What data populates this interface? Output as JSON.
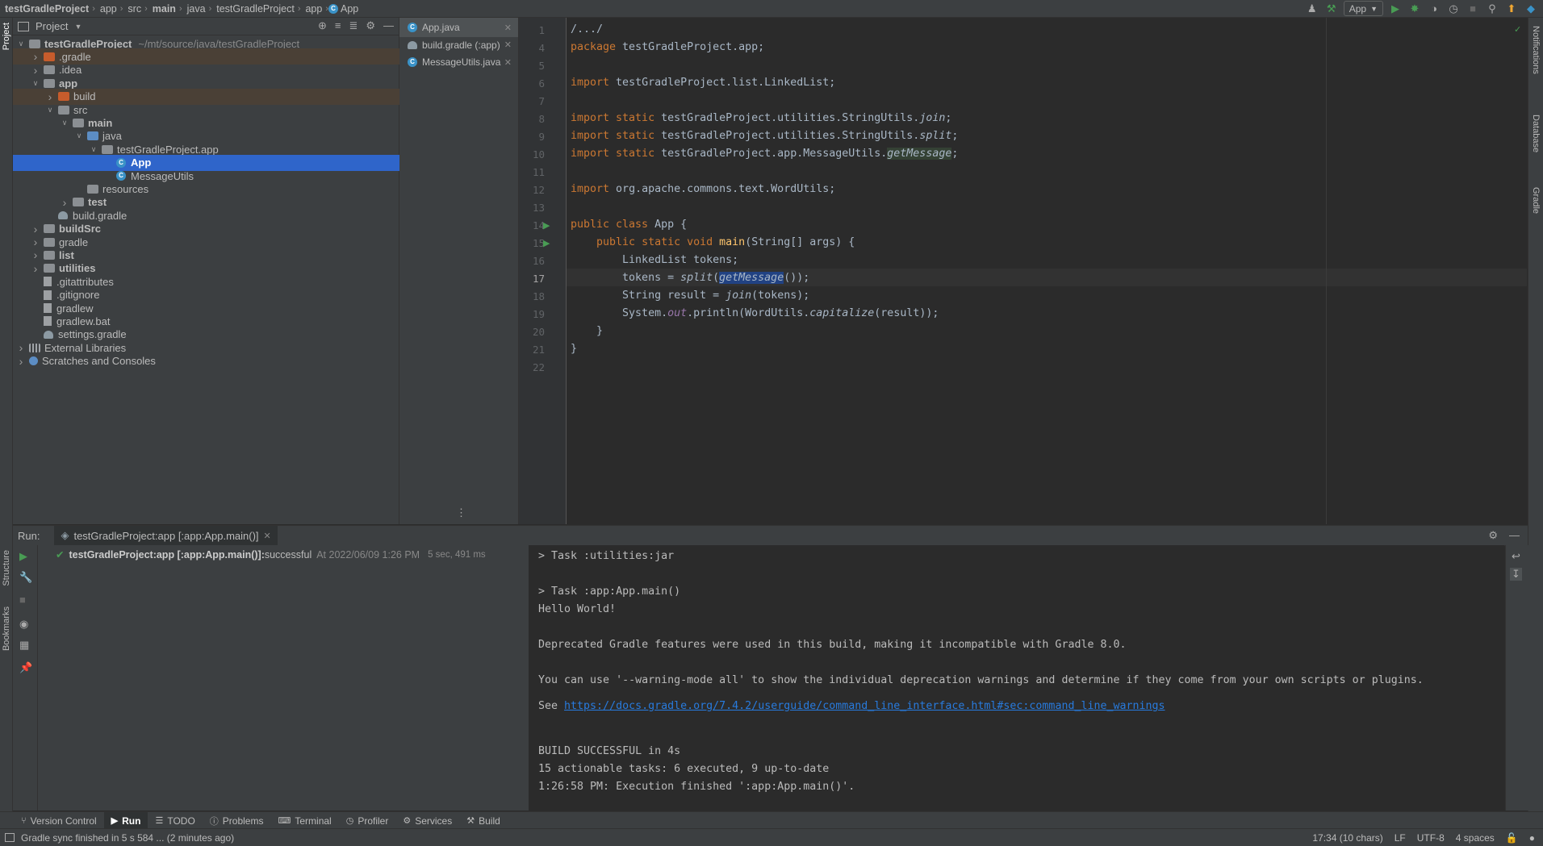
{
  "breadcrumbs": [
    "testGradleProject",
    "app",
    "src",
    "main",
    "java",
    "testGradleProject",
    "app",
    "App"
  ],
  "run_config": "App",
  "project_panel": {
    "title": "Project",
    "tree": [
      {
        "label": "testGradleProject",
        "path": "~/mt/source/java/testGradleProject",
        "indent": 0,
        "arrow": "open",
        "icon": "fold-grey",
        "bold": true
      },
      {
        "label": ".gradle",
        "indent": 1,
        "arrow": "closed",
        "icon": "fold-orange",
        "excluded": true
      },
      {
        "label": ".idea",
        "indent": 1,
        "arrow": "closed",
        "icon": "fold-grey"
      },
      {
        "label": "app",
        "indent": 1,
        "arrow": "open",
        "icon": "fold-grey",
        "bold": true
      },
      {
        "label": "build",
        "indent": 2,
        "arrow": "closed",
        "icon": "fold-orange",
        "excluded": true
      },
      {
        "label": "src",
        "indent": 2,
        "arrow": "open",
        "icon": "fold-grey"
      },
      {
        "label": "main",
        "indent": 3,
        "arrow": "open",
        "icon": "fold-grey",
        "bold": true
      },
      {
        "label": "java",
        "indent": 4,
        "arrow": "open",
        "icon": "fold-blue"
      },
      {
        "label": "testGradleProject.app",
        "indent": 5,
        "arrow": "open",
        "icon": "fold-grey"
      },
      {
        "label": "App",
        "indent": 6,
        "arrow": "none",
        "icon": "class",
        "selected": true,
        "bold": true
      },
      {
        "label": "MessageUtils",
        "indent": 6,
        "arrow": "none",
        "icon": "class"
      },
      {
        "label": "resources",
        "indent": 4,
        "arrow": "none",
        "icon": "fold-grey"
      },
      {
        "label": "test",
        "indent": 3,
        "arrow": "closed",
        "icon": "fold-grey",
        "bold": true
      },
      {
        "label": "build.gradle",
        "indent": 2,
        "arrow": "none",
        "icon": "gradle"
      },
      {
        "label": "buildSrc",
        "indent": 1,
        "arrow": "closed",
        "icon": "fold-grey",
        "bold": true
      },
      {
        "label": "gradle",
        "indent": 1,
        "arrow": "closed",
        "icon": "fold-grey"
      },
      {
        "label": "list",
        "indent": 1,
        "arrow": "closed",
        "icon": "fold-grey",
        "bold": true
      },
      {
        "label": "utilities",
        "indent": 1,
        "arrow": "closed",
        "icon": "fold-grey",
        "bold": true
      },
      {
        "label": ".gitattributes",
        "indent": 1,
        "arrow": "none",
        "icon": "file"
      },
      {
        "label": ".gitignore",
        "indent": 1,
        "arrow": "none",
        "icon": "file"
      },
      {
        "label": "gradlew",
        "indent": 1,
        "arrow": "none",
        "icon": "file"
      },
      {
        "label": "gradlew.bat",
        "indent": 1,
        "arrow": "none",
        "icon": "file"
      },
      {
        "label": "settings.gradle",
        "indent": 1,
        "arrow": "none",
        "icon": "gradle"
      },
      {
        "label": "External Libraries",
        "indent": 0,
        "arrow": "closed",
        "icon": "libs"
      },
      {
        "label": "Scratches and Consoles",
        "indent": 0,
        "arrow": "closed",
        "icon": "scratch"
      }
    ]
  },
  "editor_tabs": [
    {
      "label": "App.java",
      "active": true
    },
    {
      "label": "build.gradle (:app)",
      "active": false
    },
    {
      "label": "MessageUtils.java",
      "active": false
    }
  ],
  "editor": {
    "line_numbers": [
      "1",
      "4",
      "5",
      "6",
      "7",
      "8",
      "9",
      "10",
      "11",
      "12",
      "13",
      "14",
      "15",
      "16",
      "17",
      "18",
      "19",
      "20",
      "21",
      "22"
    ],
    "current_line": "17"
  },
  "run_panel": {
    "label": "Run:",
    "tab": "testGradleProject:app [:app:App.main()]",
    "result_task": "testGradleProject:app [:app:App.main()]:",
    "result_status": " successful",
    "result_time": "At 2022/06/09 1:26 PM",
    "result_duration": "5 sec, 491 ms",
    "console_lines": [
      "> Task :utilities:jar",
      "",
      "> Task :app:App.main()",
      "Hello World!",
      "",
      "Deprecated Gradle features were used in this build, making it incompatible with Gradle 8.0.",
      "",
      "You can use '--warning-mode all' to show the individual deprecation warnings and determine if they come from your own scripts or plugins.",
      "",
      "",
      "",
      "BUILD SUCCESSFUL in 4s",
      "15 actionable tasks: 6 executed, 9 up-to-date",
      "1:26:58 PM: Execution finished ':app:App.main()'."
    ],
    "see_prefix": "See ",
    "see_link": "https://docs.gradle.org/7.4.2/userguide/command_line_interface.html#sec:command_line_warnings"
  },
  "tool_windows": [
    {
      "label": "Version Control",
      "icon": "branch-icon"
    },
    {
      "label": "Run",
      "icon": "run-icon",
      "active": true
    },
    {
      "label": "TODO",
      "icon": "todo-icon"
    },
    {
      "label": "Problems",
      "icon": "problems-icon"
    },
    {
      "label": "Terminal",
      "icon": "terminal-icon"
    },
    {
      "label": "Profiler",
      "icon": "profiler-icon"
    },
    {
      "label": "Services",
      "icon": "services-icon"
    },
    {
      "label": "Build",
      "icon": "build-icon"
    }
  ],
  "side_labels": {
    "left_top": "Project",
    "left_structure": "Structure",
    "left_bookmarks": "Bookmarks",
    "right_notifications": "Notifications",
    "right_database": "Database",
    "right_gradle": "Gradle"
  },
  "status": {
    "message": "Gradle sync finished in 5 s 584 ... (2 minutes ago)",
    "position": "17:34 (10 chars)",
    "line_sep": "LF",
    "encoding": "UTF-8",
    "indent": "4 spaces"
  },
  "colors": {
    "accent": "#2f65ca",
    "success": "#499c54",
    "link": "#287bde",
    "keyword": "#cc7832",
    "method": "#ffc66d"
  }
}
